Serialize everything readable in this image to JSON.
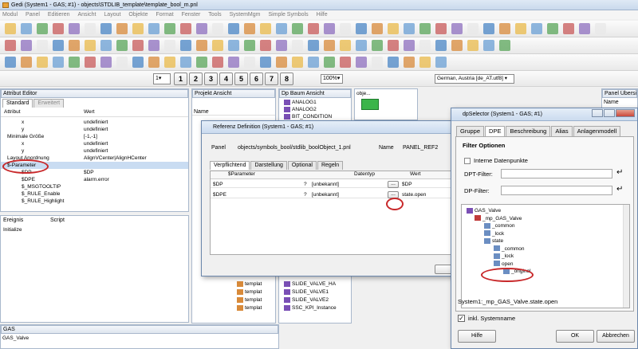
{
  "window": {
    "title": "Gedi (System1 - GAS; #1) - objects\\STDLIB_template\\template_bool_m.pnl"
  },
  "menu": [
    "Modul",
    "Panel",
    "Editieren",
    "Ansicht",
    "Layout",
    "Objekte",
    "Format",
    "Fenster",
    "Tools",
    "SystemMgm",
    "Simple Symbols",
    "Hilfe"
  ],
  "toolbar3": {
    "zoom": "100%",
    "language": "German, Austria [de_AT.utf8]",
    "layers": [
      "1",
      "2",
      "3",
      "4",
      "5",
      "6",
      "7",
      "8"
    ]
  },
  "attr_editor": {
    "title": "Attribut Editor",
    "tabs": [
      "Standard",
      "Erweitert"
    ],
    "col_attr": "Attribut",
    "col_value": "Wert",
    "rows": [
      {
        "name": "x",
        "value": "undefiniert"
      },
      {
        "name": "y",
        "value": "undefiniert"
      },
      {
        "name": "Minimale Größe",
        "value": "[-1,-1]"
      },
      {
        "name": "x",
        "value": "undefiniert"
      },
      {
        "name": "y",
        "value": "undefiniert"
      },
      {
        "name": "Layout Anordnung",
        "value": "AlignVCenter|AlignHCenter"
      },
      {
        "name": "$-Parameter",
        "value": ""
      },
      {
        "name": "$DP",
        "value": "$DP"
      },
      {
        "name": "$DPE",
        "value": "alarm.error"
      },
      {
        "name": "$_MSGTOOLTIP",
        "value": ""
      },
      {
        "name": "$_RULE_Enable",
        "value": ""
      },
      {
        "name": "$_RULE_Highlight",
        "value": ""
      }
    ],
    "event_col": "Ereignis",
    "script_col": "Script",
    "event_row": "Initialize"
  },
  "bottom_panel": {
    "header": "GAS",
    "item": "GAS_Valve"
  },
  "project": {
    "title": "Projekt Ansicht",
    "col": "Name",
    "items": [
      "templat",
      "templat",
      "templat",
      "templat"
    ]
  },
  "dp_tree": {
    "title": "Dp Baum Ansicht",
    "items": [
      "ANALOG1",
      "ANALOG2",
      "BIT_CONDITION",
      "SLIDE_VALVE_HA",
      "SLIDE_VALVE1",
      "SLIDE_VALVE2",
      "SSC_KPI_Instance"
    ]
  },
  "preview": {
    "title": "obje..."
  },
  "right_panel": {
    "title": "Panel Übersicht",
    "col": "Name"
  },
  "ref_dialog": {
    "title": "Referenz Definition (System1 - GAS; #1)",
    "panel_label": "Panel",
    "panel_value": "objects/symbols_bool/stdlib_boolObject_1.pnl",
    "name_label": "Name",
    "name_value": "PANEL_REF2",
    "tabs": [
      "Verpflichtend",
      "Darstellung",
      "Optional",
      "Regeln"
    ],
    "columns": [
      "$Parameter",
      "Datentyp",
      "Wert"
    ],
    "rows": [
      {
        "param": "$DP",
        "q": "?",
        "type": "[unbekannt]",
        "value": "$DP"
      },
      {
        "param": "$DPE",
        "q": "?",
        "type": "[unbekannt]",
        "value": "state.open"
      }
    ]
  },
  "dp_selector": {
    "title": "dpSelector (System1 - GAS; #1)",
    "tabs": [
      "Gruppe",
      "DPE",
      "Beschreibung",
      "Alias",
      "Anlagenmodell"
    ],
    "filter_title": "Filter Optionen",
    "internal_label": "Interne Datenpunkte",
    "dpt_label": "DPT-Filter:",
    "dp_label": "DP-Filter:",
    "tree": [
      "GAS_Valve",
      "_mp_GAS_Valve",
      "_common",
      "_lock",
      "state",
      "_common",
      "_lock",
      "open",
      "_original"
    ],
    "path": "System1:_mp_GAS_Valve.state.open",
    "system_name_label": "inkl. Systemname",
    "help": "Hilfe",
    "ok": "OK",
    "cancel": "Abbrechen"
  }
}
